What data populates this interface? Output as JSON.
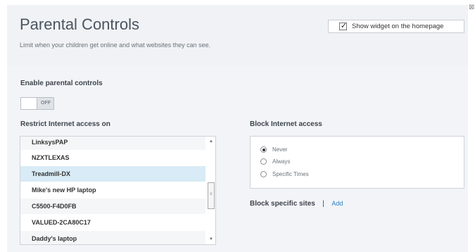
{
  "header": {
    "title": "Parental Controls",
    "subtitle": "Limit when your children get online and what websites they can see.",
    "close_icon": "close-icon",
    "widget_checkbox": {
      "label": "Show widget on the homepage",
      "checked": true
    }
  },
  "enable_section": {
    "label": "Enable parental controls",
    "toggle_state": "OFF"
  },
  "restrict_section": {
    "label": "Restrict Internet access on",
    "devices": [
      {
        "name": "LinksysPAP",
        "selected": false
      },
      {
        "name": "NZXTLEXAS",
        "selected": false
      },
      {
        "name": "Treadmill-DX",
        "selected": true
      },
      {
        "name": "Mike's new HP laptop",
        "selected": false
      },
      {
        "name": "C5500-F4D0FB",
        "selected": false
      },
      {
        "name": "VALUED-2CA80C17",
        "selected": false
      },
      {
        "name": "Daddy's laptop",
        "selected": false
      }
    ]
  },
  "block_section": {
    "label": "Block Internet access",
    "options": [
      {
        "label": "Never",
        "selected": true
      },
      {
        "label": "Always",
        "selected": false
      },
      {
        "label": "Specific Times",
        "selected": false
      }
    ]
  },
  "sites_section": {
    "label": "Block specific sites",
    "separator": "|",
    "add_label": "Add"
  },
  "colors": {
    "accent": "#2b7bbf",
    "selected_row": "#d8ebf6",
    "panel_bg": "#f2f4f7"
  }
}
